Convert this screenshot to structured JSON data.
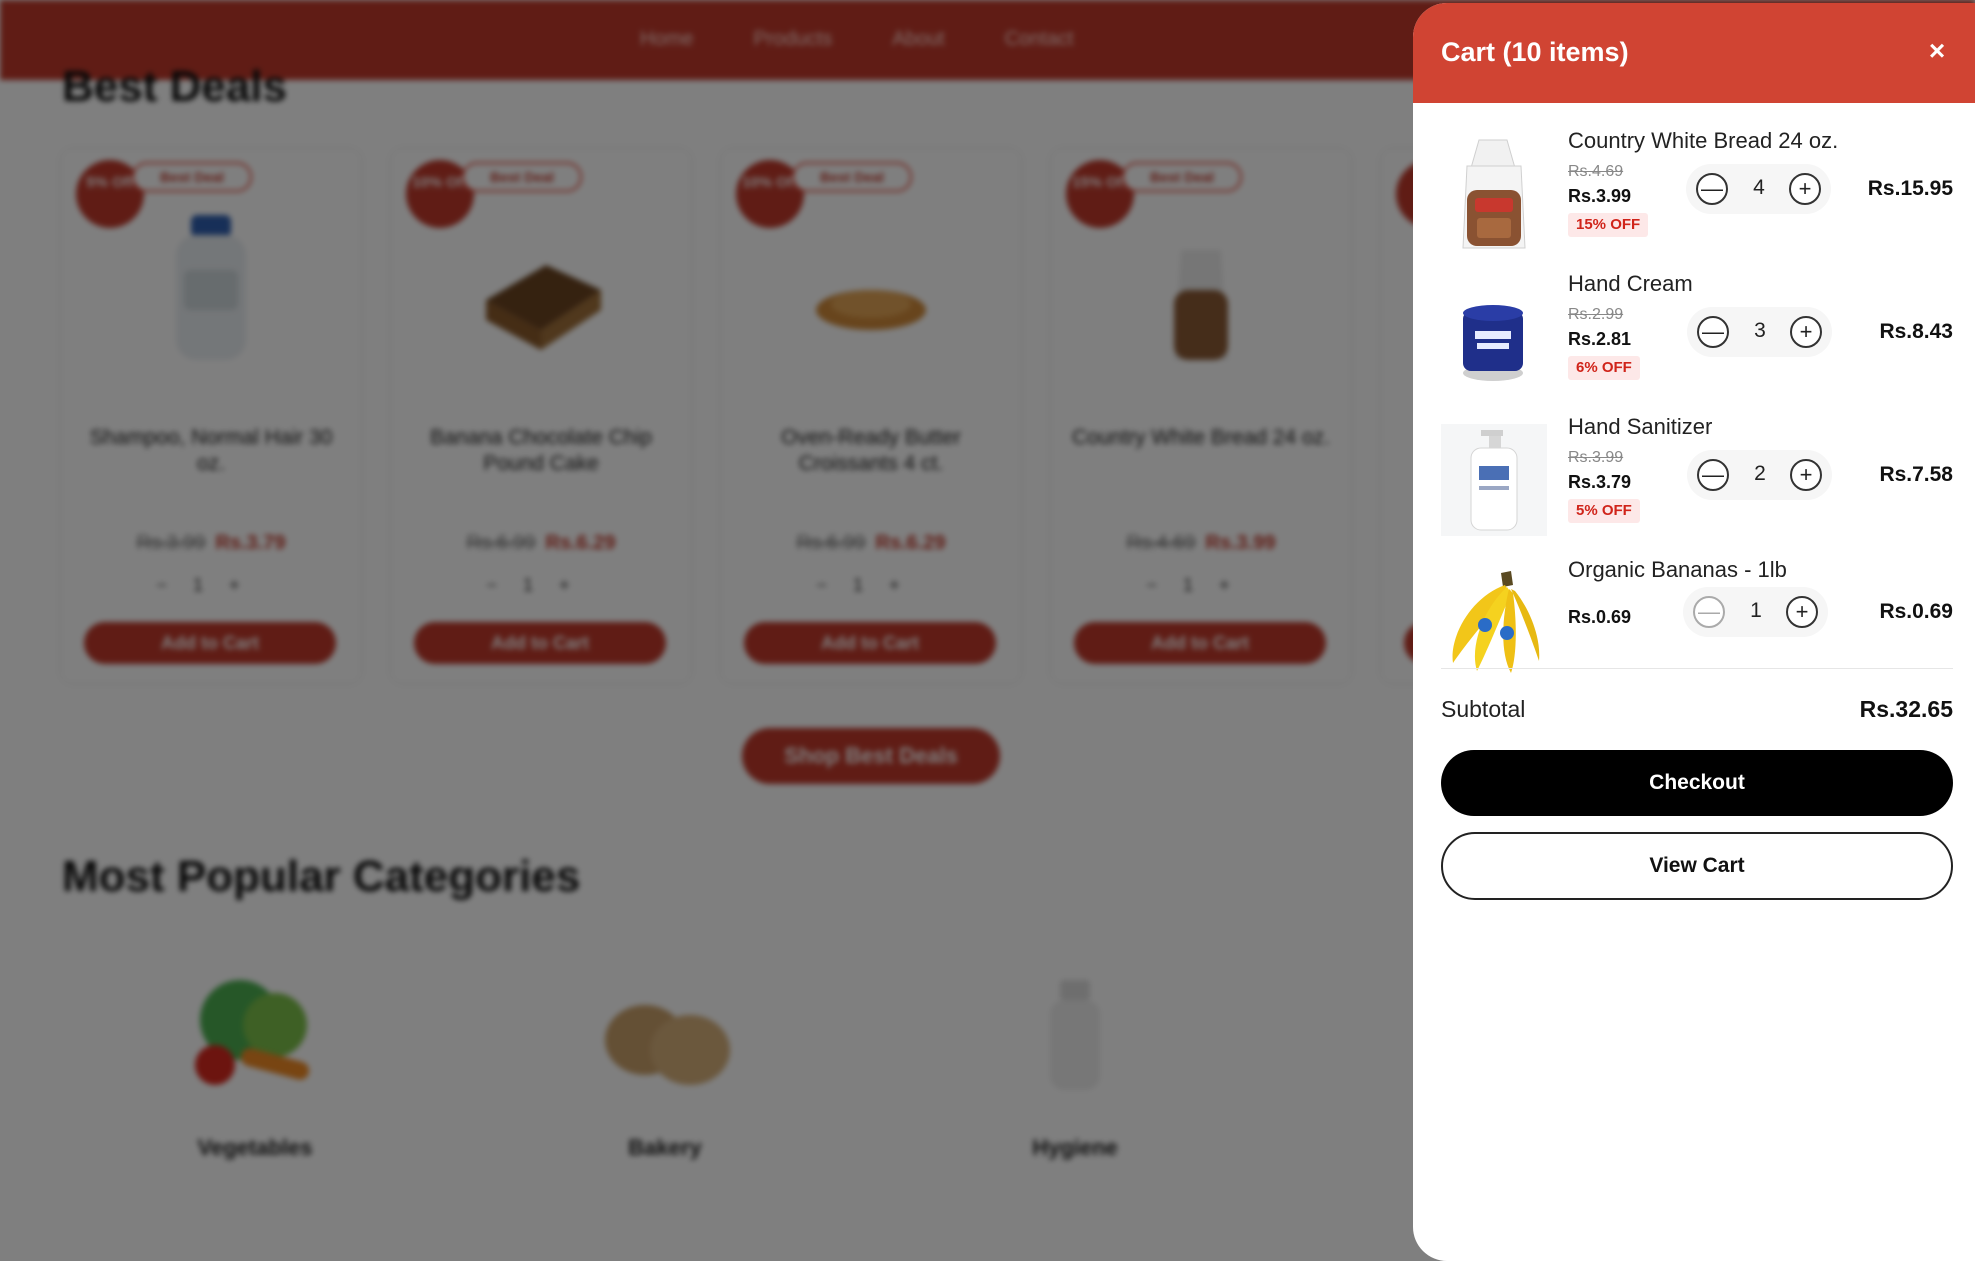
{
  "background": {
    "nav": [
      "Home",
      "Products",
      "About",
      "Contact"
    ],
    "best_deals_title": "Best Deals",
    "deals": [
      {
        "badge": "5% Off",
        "tag": "Best Deal",
        "name": "Shampoo, Normal Hair 30 oz.",
        "old_price": "Rs.3.99",
        "new_price": "Rs.3.79",
        "qty": "1",
        "button": "Add to Cart"
      },
      {
        "badge": "10% Off",
        "tag": "Best Deal",
        "name": "Banana Chocolate Chip Pound Cake",
        "old_price": "Rs.6.99",
        "new_price": "Rs.6.29",
        "qty": "1",
        "button": "Add to Cart"
      },
      {
        "badge": "10% Off",
        "tag": "Best Deal",
        "name": "Oven-Ready Butter Croissants 4 ct.",
        "old_price": "Rs.6.99",
        "new_price": "Rs.6.29",
        "qty": "1",
        "button": "Add to Cart"
      },
      {
        "badge": "15% Off",
        "tag": "Best Deal",
        "name": "Country White Bread 24 oz.",
        "old_price": "Rs.4.69",
        "new_price": "Rs.3.99",
        "qty": "1",
        "button": "Add to Cart"
      }
    ],
    "shop_deals_button": "Shop Best Deals",
    "popular_title": "Most Popular Categories",
    "categories": [
      "Vegetables",
      "Bakery",
      "Hygiene"
    ]
  },
  "cart": {
    "title": "Cart (10 items)",
    "close_icon": "×",
    "items": [
      {
        "name": "Country White Bread 24 oz.",
        "old_price": "Rs.4.69",
        "price": "Rs.3.99",
        "discount": "15% OFF",
        "qty": "4",
        "total": "Rs.15.95",
        "icon": "bread-image"
      },
      {
        "name": "Hand Cream",
        "old_price": "Rs.2.99",
        "price": "Rs.2.81",
        "discount": "6% OFF",
        "qty": "3",
        "total": "Rs.8.43",
        "icon": "hand-cream-image"
      },
      {
        "name": "Hand Sanitizer",
        "old_price": "Rs.3.99",
        "price": "Rs.3.79",
        "discount": "5% OFF",
        "qty": "2",
        "total": "Rs.7.58",
        "icon": "hand-sanitizer-image"
      },
      {
        "name": "Organic Bananas - 1lb",
        "price": "Rs.0.69",
        "qty": "1",
        "total": "Rs.0.69",
        "icon": "bananas-image"
      }
    ],
    "minus_symbol": "—",
    "plus_symbol": "+",
    "subtotal_label": "Subtotal",
    "subtotal_value": "Rs.32.65",
    "checkout_label": "Checkout",
    "view_cart_label": "View Cart"
  },
  "colors": {
    "brand_red": "#d04433",
    "discount_red": "#d0241a",
    "checkout_black": "#000000"
  }
}
